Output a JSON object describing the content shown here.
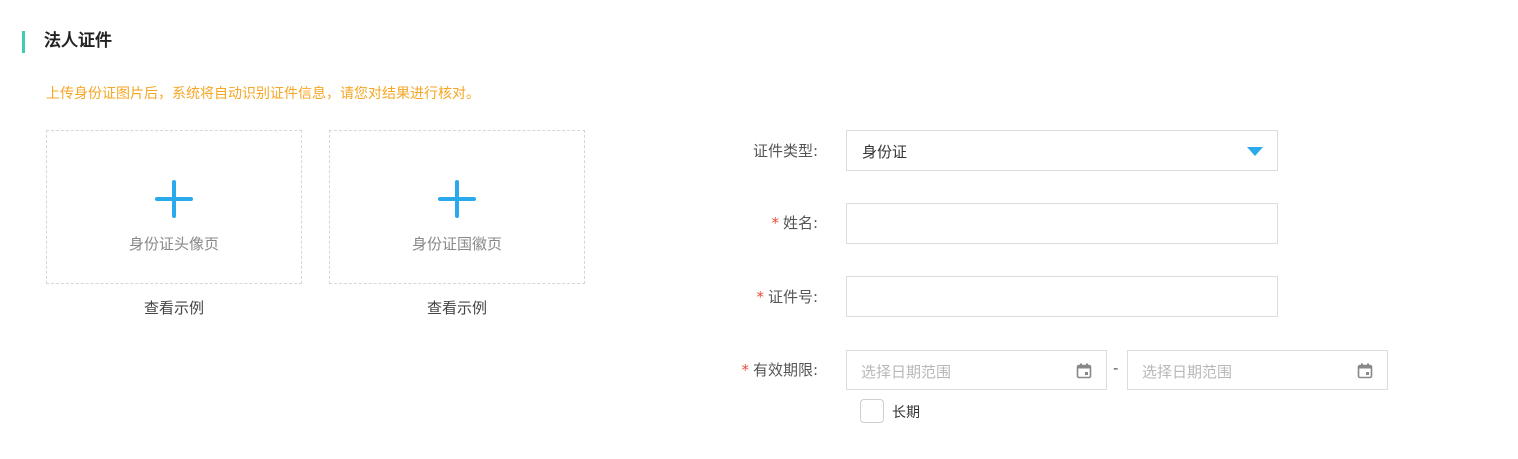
{
  "section": {
    "title": "法人证件"
  },
  "hint": "上传身份证图片后，系统将自动识别证件信息，请您对结果进行核对。",
  "uploads": [
    {
      "label": "身份证头像页",
      "example": "查看示例",
      "icon": "plus-icon"
    },
    {
      "label": "身份证国徽页",
      "example": "查看示例",
      "icon": "plus-icon"
    }
  ],
  "form": {
    "id_type": {
      "label": "证件类型:",
      "value": "身份证",
      "icon": "caret-down-icon"
    },
    "name": {
      "required_mark": "*",
      "label": "姓名:",
      "value": ""
    },
    "id_number": {
      "required_mark": "*",
      "label": "证件号:",
      "value": ""
    },
    "validity": {
      "required_mark": "*",
      "label": "有效期限:",
      "start_placeholder": "选择日期范围",
      "end_placeholder": "选择日期范围",
      "separator": "-",
      "icon": "calendar-icon",
      "long_term_label": "长期",
      "long_term_checked": false
    }
  },
  "colors": {
    "accent": "#3ecdb4",
    "primary": "#2aa9ec",
    "hint": "#f5a623",
    "required": "#e84c3d"
  }
}
